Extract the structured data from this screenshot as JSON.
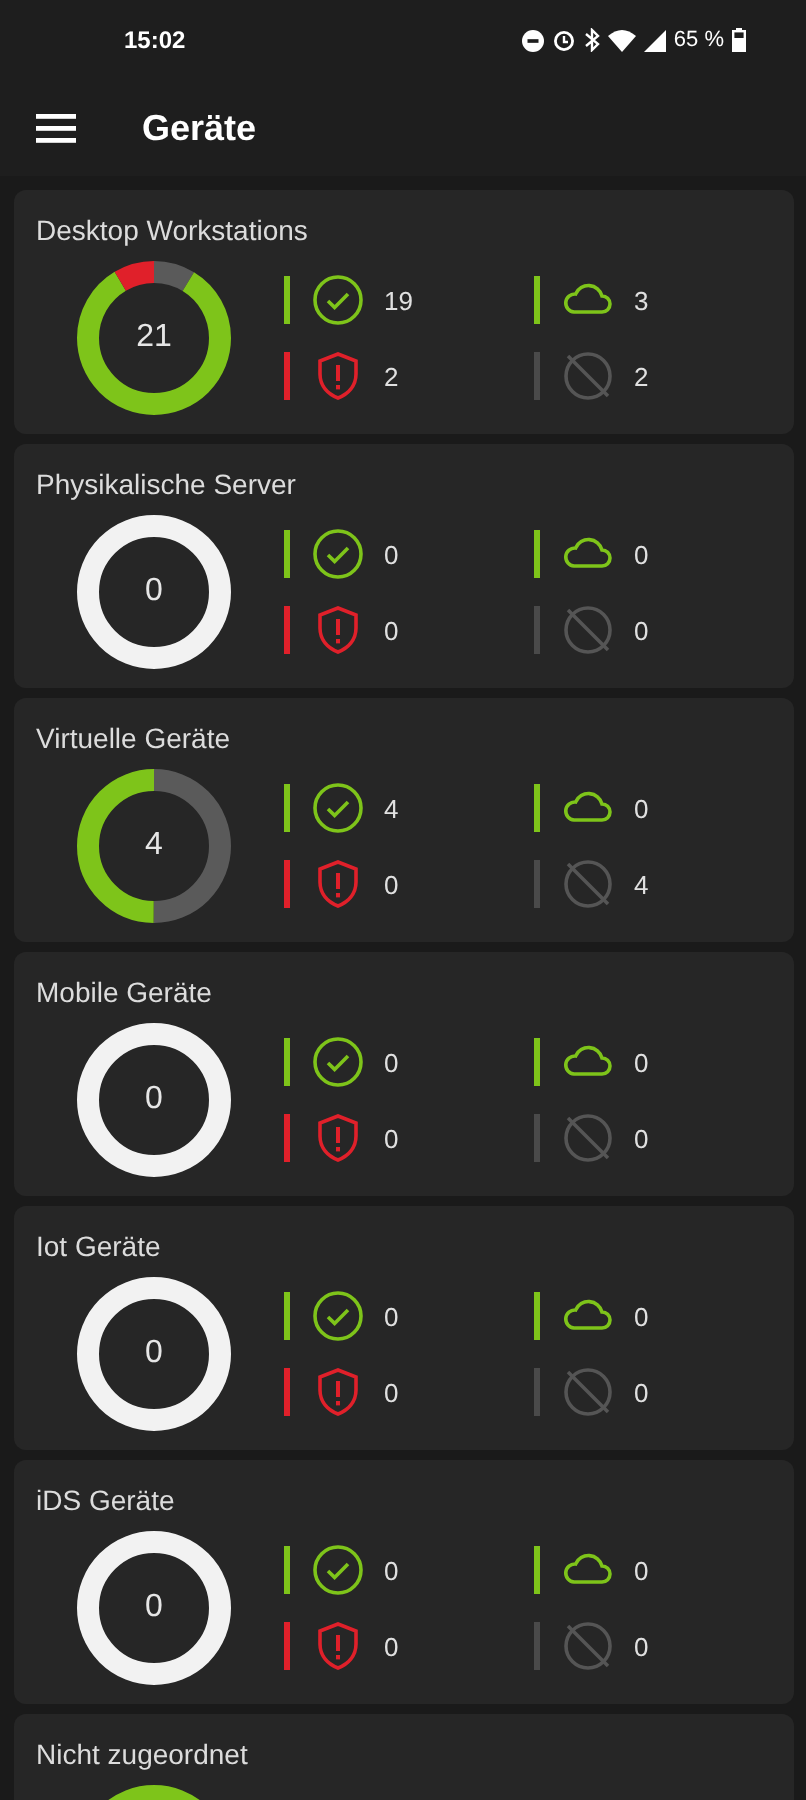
{
  "status_bar": {
    "time": "15:02",
    "battery": "65 %"
  },
  "app_bar": {
    "title": "Geräte"
  },
  "cards": [
    {
      "kind": "full",
      "title": "Desktop Workstations",
      "total": "21",
      "ok": "19",
      "alert": "2",
      "online": "3",
      "offline": "2"
    },
    {
      "kind": "full",
      "title": "Physikalische Server",
      "total": "0",
      "ok": "0",
      "alert": "0",
      "online": "0",
      "offline": "0"
    },
    {
      "kind": "full",
      "title": "Virtuelle Geräte",
      "total": "4",
      "ok": "4",
      "alert": "0",
      "online": "0",
      "offline": "4"
    },
    {
      "kind": "full",
      "title": "Mobile Geräte",
      "total": "0",
      "ok": "0",
      "alert": "0",
      "online": "0",
      "offline": "0"
    },
    {
      "kind": "full",
      "title": "Iot Geräte",
      "total": "0",
      "ok": "0",
      "alert": "0",
      "online": "0",
      "offline": "0"
    },
    {
      "kind": "full",
      "title": "iDS Geräte",
      "total": "0",
      "ok": "0",
      "alert": "0",
      "online": "0",
      "offline": "0"
    },
    {
      "kind": "cut",
      "title": "Nicht zugeordnet"
    }
  ]
}
